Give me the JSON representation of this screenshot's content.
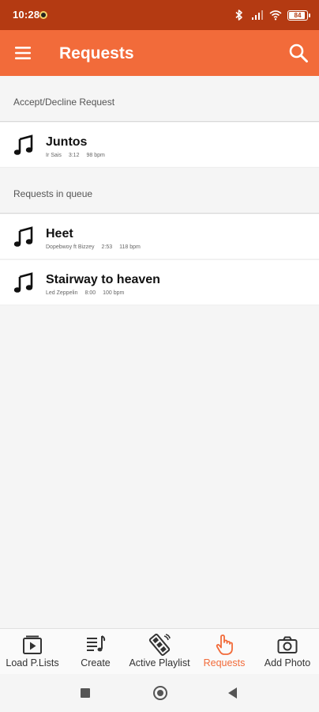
{
  "status_bar": {
    "time": "10:28",
    "battery": "84",
    "battery_level": 0.84
  },
  "header": {
    "title": "Requests"
  },
  "sections": {
    "pending": {
      "label": "Accept/Decline Request"
    },
    "queue": {
      "label": "Requests in queue"
    }
  },
  "pending_requests": [
    {
      "title": "Juntos",
      "artist": "Ir Sais",
      "duration": "3:12",
      "bpm": "98 bpm"
    }
  ],
  "queue_requests": [
    {
      "title": "Heet",
      "artist": "Dopebwoy ft Bizzey",
      "duration": "2:53",
      "bpm": "118 bpm"
    },
    {
      "title": "Stairway to heaven",
      "artist": "Led Zeppelin",
      "duration": "8:00",
      "bpm": "100 bpm"
    }
  ],
  "bottom_nav": [
    {
      "label": "Load P.Lists",
      "icon": "playlist-play-icon",
      "active": false
    },
    {
      "label": "Create",
      "icon": "create-playlist-icon",
      "active": false
    },
    {
      "label": "Active Playlist",
      "icon": "film-reel-icon",
      "active": false
    },
    {
      "label": "Requests",
      "icon": "hand-tap-icon",
      "active": true
    },
    {
      "label": "Add Photo",
      "icon": "camera-icon",
      "active": false
    }
  ],
  "colors": {
    "status_bar": "#b43a12",
    "app_bar": "#f26b3a",
    "accent": "#f26b3a"
  }
}
